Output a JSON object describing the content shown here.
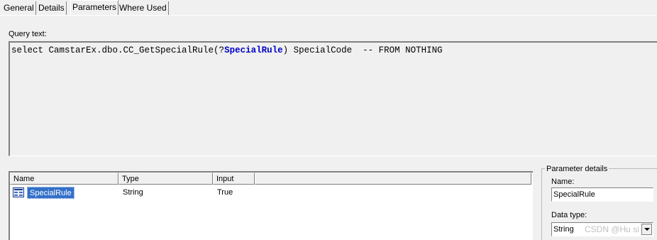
{
  "tabs": [
    {
      "label": "General"
    },
    {
      "label": "Details"
    },
    {
      "label": "Parameters"
    },
    {
      "label": "Where Used"
    }
  ],
  "query": {
    "label": "Query text:",
    "text_before": "select CamstarEx.dbo.CC_GetSpecialRule(?",
    "parameter": "SpecialRule",
    "text_after": ") SpecialCode  -- FROM NOTHING"
  },
  "params_table": {
    "columns": [
      "Name",
      "Type",
      "Input"
    ],
    "rows": [
      {
        "name": "SpecialRule",
        "type": "String",
        "input": "True"
      }
    ]
  },
  "parameter_details": {
    "title": "Parameter details",
    "name_label": "Name:",
    "name_value": "SpecialRule",
    "data_type_label": "Data type:",
    "data_type_value": "String"
  },
  "watermark": "CSDN @Hu  si",
  "colors": {
    "selection": "#3370c8",
    "parameter_text": "#0000c8"
  }
}
